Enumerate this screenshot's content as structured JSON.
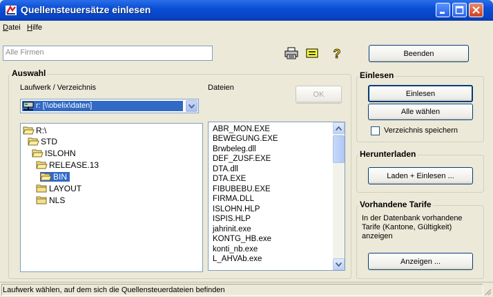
{
  "window": {
    "title": "Quellensteuersätze einlesen"
  },
  "menu": [
    {
      "label": "Datei",
      "accel": "D"
    },
    {
      "label": "Hilfe",
      "accel": "H"
    }
  ],
  "toolbar": {
    "company_placeholder": "Alle Firmen",
    "exit_label": "Beenden"
  },
  "auswahl": {
    "title": "Auswahl",
    "drive_label": "Laufwerk / Verzeichnis",
    "files_label": "Dateien",
    "ok_label": "OK",
    "drive_value": "r: [\\\\obelix\\daten]",
    "tree": [
      {
        "label": "R:\\",
        "selected": false
      },
      {
        "label": "STD",
        "selected": false
      },
      {
        "label": "ISLOHN",
        "selected": false
      },
      {
        "label": "RELEASE.13",
        "selected": false
      },
      {
        "label": "BIN",
        "selected": true
      },
      {
        "label": "LAYOUT",
        "selected": false
      },
      {
        "label": "NLS",
        "selected": false
      }
    ],
    "files": [
      "ABR_MON.EXE",
      "BEWEGUNG.EXE",
      "Brwbeleg.dll",
      "DEF_ZUSF.EXE",
      "DTA.dll",
      "DTA.EXE",
      "FIBUBEBU.EXE",
      "FIRMA.DLL",
      "ISLOHN.HLP",
      "ISPIS.HLP",
      "jahrinit.exe",
      "KONTG_HB.exe",
      "konti_nb.exe",
      "L_AHVAb.exe"
    ]
  },
  "einlesen": {
    "title": "Einlesen",
    "read_label": "Einlesen",
    "select_all_label": "Alle wählen",
    "save_dir_label": "Verzeichnis speichern",
    "save_dir_checked": false
  },
  "herunterladen": {
    "title": "Herunterladen",
    "load_label": "Laden + Einlesen ..."
  },
  "tarife": {
    "title": "Vorhandene Tarife",
    "description": "In der Datenbank vorhandene Tarife (Kantone, Gültigkeit) anzeigen",
    "show_label": "Anzeigen ..."
  },
  "status": {
    "text": "Laufwerk wählen, auf dem sich die Quellensteuerdateien befinden"
  }
}
